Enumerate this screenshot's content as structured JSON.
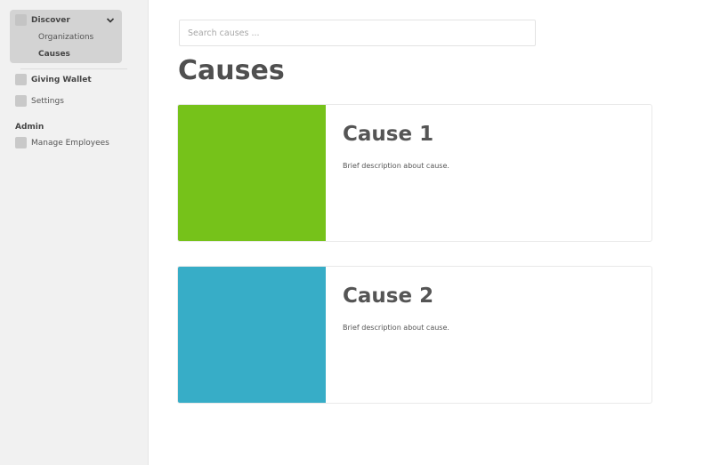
{
  "sidebar": {
    "discover": {
      "label": "Discover",
      "expanded": true,
      "items": [
        {
          "label": "Organizations",
          "active": false
        },
        {
          "label": "Causes",
          "active": true
        }
      ]
    },
    "items": [
      {
        "label": "Giving Wallet"
      },
      {
        "label": "Settings"
      }
    ],
    "admin": {
      "heading": "Admin",
      "items": [
        {
          "label": "Manage Employees"
        }
      ]
    }
  },
  "search": {
    "placeholder": "Search causes ...",
    "value": ""
  },
  "main": {
    "title": "Causes",
    "causes": [
      {
        "title": "Cause 1",
        "description": "Brief description about cause.",
        "image_color": "#76c21a"
      },
      {
        "title": "Cause 2",
        "description": "Brief description about cause.",
        "image_color": "#37adc7"
      }
    ]
  },
  "colors": {
    "sidebar_bg": "#f1f1f1",
    "nav_group_bg": "#d3d3d3",
    "text": "#555555"
  },
  "icons": {
    "nav_item": "square-icon",
    "expand": "chevron-down-icon"
  }
}
